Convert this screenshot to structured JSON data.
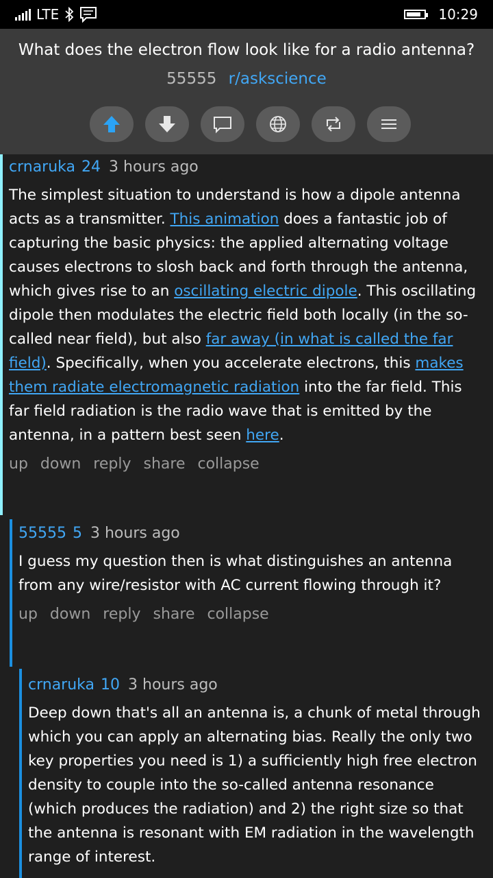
{
  "status": {
    "network": "LTE",
    "time": "10:29",
    "icons": [
      "signal-icon",
      "bluetooth-icon",
      "message-icon",
      "battery-icon"
    ]
  },
  "post": {
    "title": "What does the electron flow look like for a radio antenna?",
    "score": "55555",
    "subreddit": "r/askscience",
    "actions": [
      "upvote-icon",
      "downvote-icon",
      "comments-icon",
      "web-icon",
      "share-icon",
      "menu-icon"
    ]
  },
  "actions": {
    "up": "up",
    "down": "down",
    "reply": "reply",
    "share": "share",
    "collapse": "collapse"
  },
  "comments": [
    {
      "author": "crnaruka",
      "score": "24",
      "time": "3 hours ago",
      "body": {
        "t1": "The simplest situation to understand is how a dipole antenna acts as a transmitter. ",
        "l1": "This animation",
        "t2": " does a fantastic job of capturing the basic physics: the applied alternating voltage causes electrons to slosh back and forth through the antenna, which gives rise to an ",
        "l2": "oscillating electric dipole",
        "t3": ". This oscillating dipole then modulates the electric field both locally (in the so-called near field), but also ",
        "l3": "far away (in what is called the far field)",
        "t4": ". Specifically, when you accelerate electrons, this ",
        "l4": "makes them radiate electromagnetic radiation",
        "t5": " into the far field. This far field radiation is the radio wave that is emitted by the antenna, in a pattern best seen ",
        "l5": "here",
        "t6": "."
      },
      "bar_color": "#8ff0ff"
    },
    {
      "author": "55555",
      "score": "5",
      "time": "3 hours ago",
      "body": "I guess my question then is what distinguishes an antenna from any wire/resistor with AC current flowing through it?",
      "bar_color": "#1b8fe0"
    },
    {
      "author": "crnaruka",
      "score": "10",
      "time": "3 hours ago",
      "body": "Deep down that's all an antenna is, a chunk of metal through which you can apply an alternating bias. Really the only two key properties you need is 1) a sufficiently high free electron density to couple into the so-called antenna resonance (which produces the radiation) and 2) the right size so that the antenna is resonant with EM radiation in the wavelength range of interest.",
      "bar_color": "#1b8fe0"
    }
  ],
  "colors": {
    "accent": "#41a7f5",
    "header_bg": "#3b3b3b",
    "page_bg": "#1f1f1f",
    "upvoted": "#2ba3f5"
  }
}
